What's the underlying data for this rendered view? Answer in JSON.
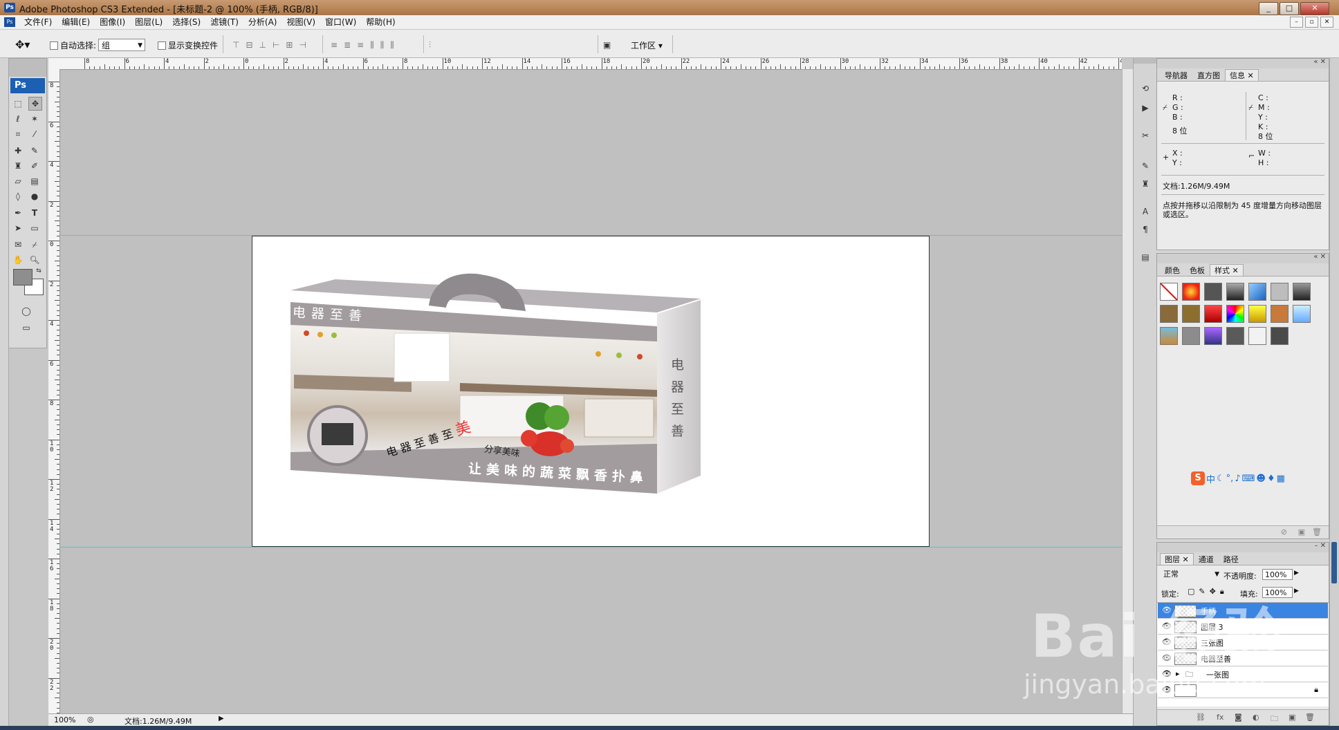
{
  "window": {
    "title": "Adobe Photoshop CS3 Extended - [未标题-2 @ 100% (手柄, RGB/8)]",
    "app_icon": "Ps",
    "controls": [
      "_",
      "□",
      "✕"
    ]
  },
  "menu": {
    "items": [
      "文件(F)",
      "编辑(E)",
      "图像(I)",
      "图层(L)",
      "选择(S)",
      "滤镜(T)",
      "分析(A)",
      "视图(V)",
      "窗口(W)",
      "帮助(H)"
    ]
  },
  "options": {
    "auto_select_label": "自动选择:",
    "auto_select_value": "组",
    "show_transform_label": "显示变换控件",
    "workspace_label": "工作区 ▾"
  },
  "toolbox": {
    "logo": "Ps"
  },
  "rulers": {
    "top_labels": [
      "8",
      "6",
      "4",
      "2",
      "0",
      "2",
      "4",
      "6",
      "8",
      "10",
      "12",
      "14",
      "16",
      "18",
      "20",
      "22",
      "24",
      "26",
      "28",
      "30",
      "32",
      "34",
      "36",
      "38",
      "40",
      "42",
      "44"
    ],
    "left_labels": [
      "8",
      "6",
      "4",
      "2",
      "0",
      "2",
      "4",
      "6",
      "8",
      "10",
      "12",
      "14",
      "16",
      "18",
      "20",
      "22",
      "24"
    ]
  },
  "document": {
    "box_top_text": "电器至善",
    "box_side_text": "电器至善",
    "box_slogan": "电器至善至",
    "box_slogan_accent": "美",
    "box_share": "分享美味",
    "box_bottom_text": "让美味的蔬菜飘香扑鼻"
  },
  "status": {
    "zoom": "100%",
    "doc_size": "文档:1.26M/9.49M"
  },
  "info_panel": {
    "tabs": [
      "导航器",
      "直方图",
      "信息"
    ],
    "active_tab": "信息",
    "rgb_labels": [
      "R :",
      "G :",
      "B :"
    ],
    "cmyk_labels": [
      "C :",
      "M :",
      "Y :",
      "K :"
    ],
    "bit_depth_left": "8 位",
    "bit_depth_right": "8 位",
    "xy_labels": [
      "X :",
      "Y :"
    ],
    "wh_labels": [
      "W :",
      "H :"
    ],
    "doc_size": "文档:1.26M/9.49M",
    "hint": "点按并拖移以沿限制为 45 度增量方向移动图层或选区。"
  },
  "styles_panel": {
    "tabs": [
      "颜色",
      "色板",
      "样式"
    ],
    "active_tab": "样式"
  },
  "layers_panel": {
    "tabs": [
      "图层",
      "通道",
      "路径"
    ],
    "active_tab": "图层",
    "blend_mode": "正常",
    "opacity_label": "不透明度:",
    "opacity_value": "100%",
    "lock_label": "锁定:",
    "fill_label": "填充:",
    "fill_value": "100%",
    "layers": [
      {
        "name": "手柄",
        "selected": true
      },
      {
        "name": "图层 3",
        "selected": false
      },
      {
        "name": "三张图",
        "selected": false
      },
      {
        "name": "电器至善",
        "selected": false
      },
      {
        "name": "一张图",
        "selected": false,
        "group": true
      },
      {
        "name": "",
        "selected": false,
        "background": true
      }
    ]
  },
  "ime": {
    "items": [
      "中",
      "◐",
      "°,",
      "🎤",
      "⌨",
      "👤",
      "👕",
      "⋮⋮"
    ]
  },
  "watermark": {
    "brand": "Bai 经验",
    "url": "jingyan.baidu.com"
  },
  "colors": {
    "accent_selected": "#3a84e2",
    "box_gray": "#a29c9f",
    "guide": "#3cc7c7"
  }
}
